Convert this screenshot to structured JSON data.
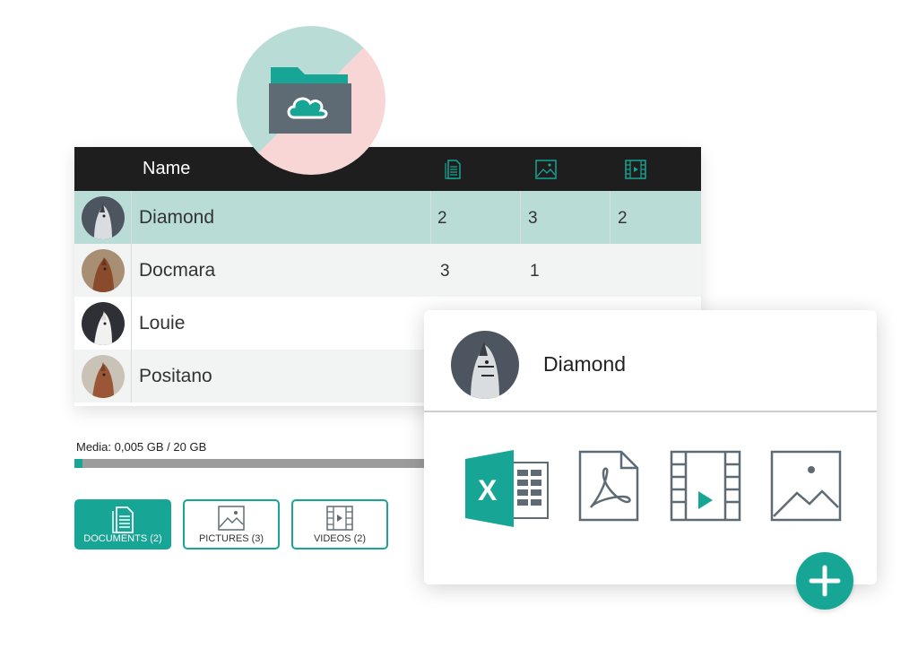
{
  "table": {
    "header": {
      "name_label": "Name",
      "icons": [
        "document-icon",
        "picture-icon",
        "video-icon"
      ]
    },
    "rows": [
      {
        "name": "Diamond",
        "documents": "2",
        "pictures": "3",
        "videos": "2",
        "selected": true
      },
      {
        "name": "Docmara",
        "documents": "3",
        "pictures": "1",
        "videos": ""
      },
      {
        "name": "Louie",
        "documents": "",
        "pictures": "",
        "videos": ""
      },
      {
        "name": "Positano",
        "documents": "",
        "pictures": "",
        "videos": ""
      }
    ]
  },
  "media": {
    "label": "Media: 0,005 GB / 20 GB",
    "used_fraction": 0.00025
  },
  "filters": [
    {
      "label": "DOCUMENTS (2)",
      "icon": "document-icon",
      "active": true
    },
    {
      "label": "PICTURES (3)",
      "icon": "picture-icon",
      "active": false
    },
    {
      "label": "VIDEOS (2)",
      "icon": "video-icon",
      "active": false
    }
  ],
  "detail": {
    "name": "Diamond",
    "file_icons": [
      "excel-icon",
      "pdf-icon",
      "video-file-icon",
      "image-file-icon"
    ]
  },
  "colors": {
    "accent": "#17a595",
    "selected_row": "#b9ddd6",
    "header_bg": "#1e1e1e",
    "excel": "#17a595"
  }
}
